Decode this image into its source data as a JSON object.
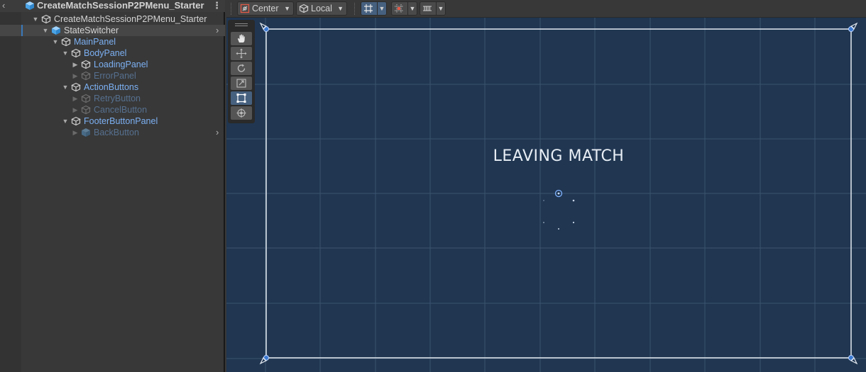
{
  "hierarchy": {
    "header_title": "CreateMatchSessionP2PMenu_Starter",
    "items": [
      {
        "label": "CreateMatchSessionP2PMenu_Starter"
      },
      {
        "label": "StateSwitcher"
      },
      {
        "label": "MainPanel"
      },
      {
        "label": "BodyPanel"
      },
      {
        "label": "LoadingPanel"
      },
      {
        "label": "ErrorPanel"
      },
      {
        "label": "ActionButtons"
      },
      {
        "label": "RetryButton"
      },
      {
        "label": "CancelButton"
      },
      {
        "label": "FooterButtonPanel"
      },
      {
        "label": "BackButton"
      }
    ]
  },
  "toolbar": {
    "pivot_label": "Center",
    "space_label": "Local"
  },
  "scene": {
    "ui_text": "LEAVING MATCH"
  },
  "colors": {
    "scene_bg": "#203651",
    "selection_accent": "#3a79bb",
    "prefab_label": "#7cb0f2"
  },
  "icons": {
    "scene_root": "unity-scene-cube-icon",
    "game_object": "gameobject-cube-icon",
    "prefab": "prefab-cube-icon",
    "tools": [
      "hand-tool-icon",
      "move-tool-icon",
      "rotate-tool-icon",
      "scale-tool-icon",
      "rect-tool-icon",
      "transform-tool-icon"
    ]
  }
}
